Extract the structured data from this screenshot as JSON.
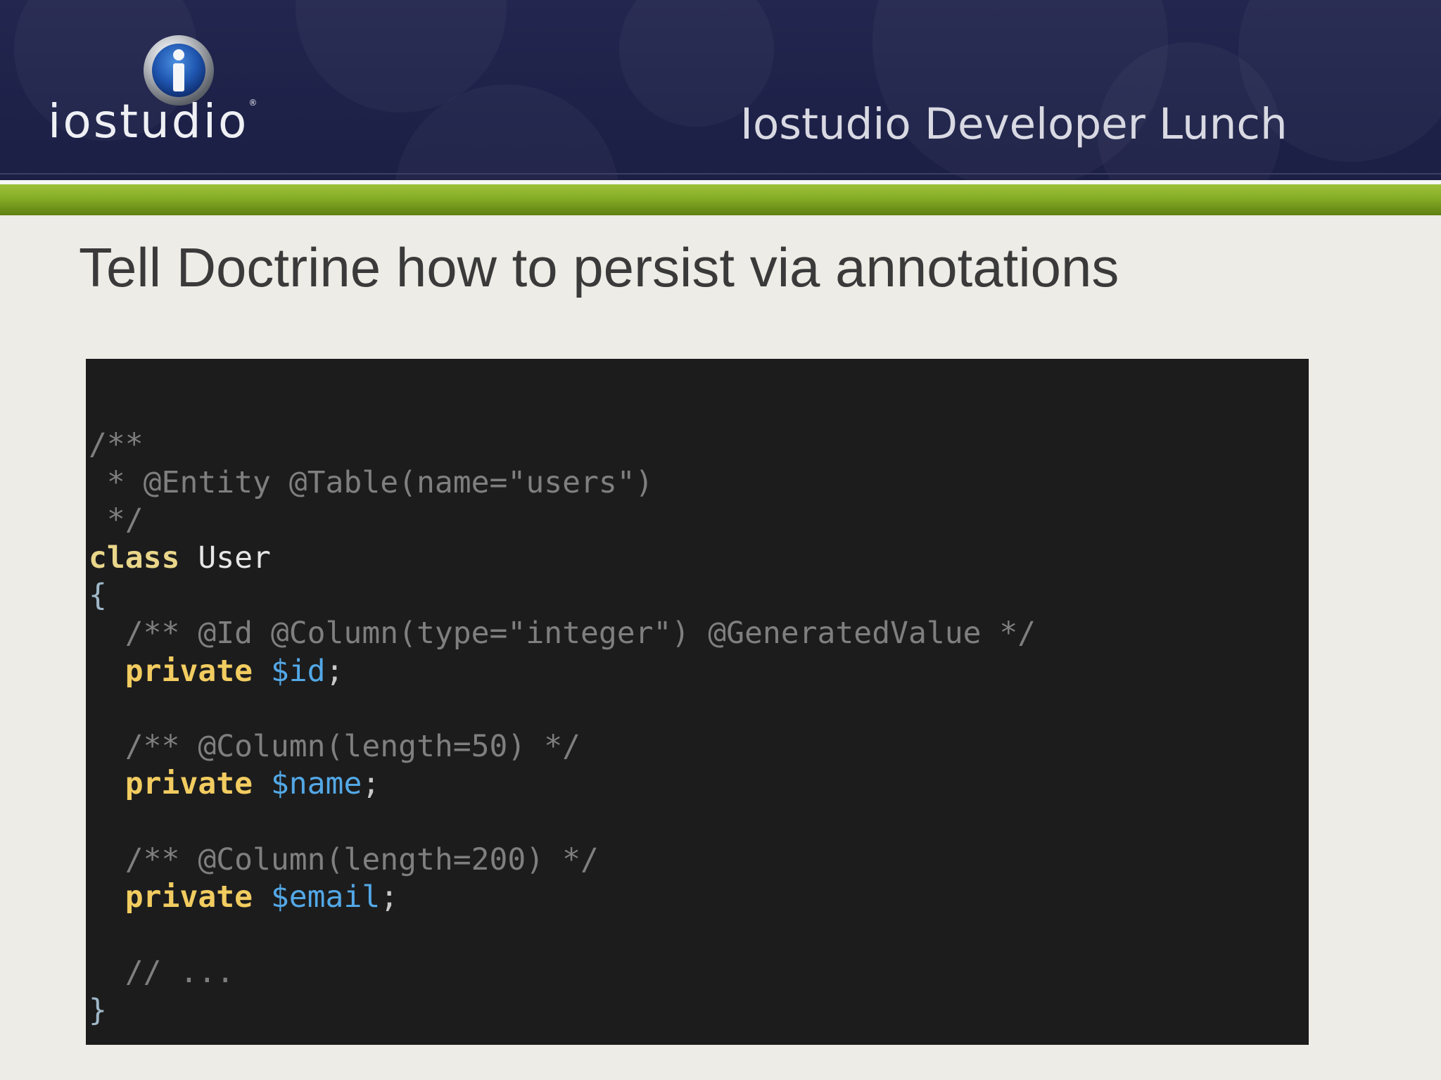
{
  "header": {
    "logo_text": "iostudio",
    "logo_mark": "®",
    "title": "Iostudio Developer Lunch"
  },
  "slide": {
    "title": "Tell Doctrine how to persist via annotations"
  },
  "code": {
    "lines": [
      {
        "comment": "/**"
      },
      {
        "comment": " * @Entity @Table(name=\"users\")"
      },
      {
        "comment": " */"
      },
      {
        "keyword": "class",
        "name": "User"
      },
      {
        "brace": "{"
      },
      {
        "comment": "  /** @Id @Column(type=\"integer\") @GeneratedValue */"
      },
      {
        "keyword": "private",
        "variable": "$id",
        "punct": ";"
      },
      {
        "blank": ""
      },
      {
        "comment": "  /** @Column(length=50) */"
      },
      {
        "keyword": "private",
        "variable": "$name",
        "punct": ";"
      },
      {
        "blank": ""
      },
      {
        "comment": "  /** @Column(length=200) */"
      },
      {
        "keyword": "private",
        "variable": "$email",
        "punct": ";"
      },
      {
        "blank": ""
      },
      {
        "comment": "  // ..."
      },
      {
        "brace": "}"
      }
    ]
  },
  "colors": {
    "header_bg": "#1e2249",
    "accent_green": "#86ad26",
    "code_bg": "#1c1c1d",
    "comment": "#7f7f7f",
    "keyword": "#f2cc60",
    "variable": "#53a8e6"
  }
}
